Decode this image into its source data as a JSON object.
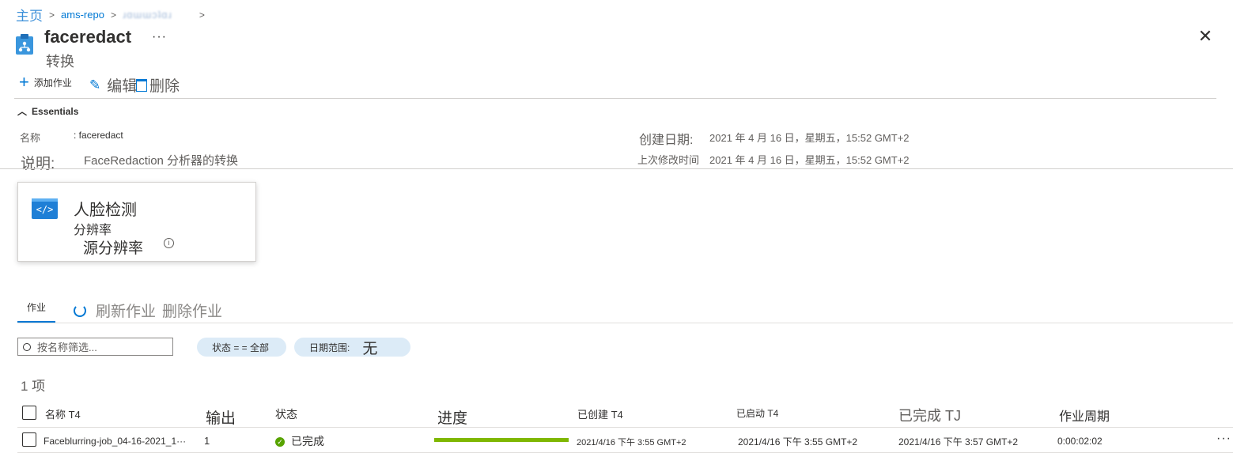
{
  "breadcrumb": {
    "home": "主页",
    "repo": "ams-repo",
    "blurred": "ɹɑɯɯɔʇɑɹ"
  },
  "header": {
    "title": "faceredact",
    "more": "···",
    "subtitle": "转换",
    "close": "✕"
  },
  "commands": {
    "add_job": "添加作业",
    "edit": "编辑",
    "delete": "删除"
  },
  "essentials": {
    "toggle": "Essentials",
    "name_label": "名称",
    "name_value": ": faceredact",
    "desc_label": "说明:",
    "desc_value": "FaceRedaction 分析器的转换",
    "created_label": "创建日期:",
    "created_value": "2021 年 4 月 16 日，星期五，15:52 GMT+2",
    "modified_label": "上次修改时间",
    "modified_value": "2021 年 4 月 16 日，星期五，15:52 GMT+2"
  },
  "card": {
    "icon": "</>",
    "title": "人脸检测",
    "line1": "分辨率",
    "line2": "源分辨率",
    "info": "i"
  },
  "jobs_tab": {
    "tab": "作业",
    "refresh": "刷新作业",
    "delete": "删除作业"
  },
  "filters": {
    "search_placeholder": "按名称筛选...",
    "status_pill": "状态 =  = 全部",
    "date_label": "日期范围:",
    "date_value": "无"
  },
  "count": "1 项",
  "table": {
    "headers": {
      "name": "名称 T4",
      "output": "输出",
      "status": "状态",
      "progress": "进度",
      "created": "已创建 T4",
      "started": "已启动 T4",
      "finished": "已完成 TJ",
      "duration": "作业周期"
    },
    "rows": [
      {
        "name": "Faceblurring-job_04-16-2021_1···",
        "output": "1",
        "status": "已完成",
        "progress": 1.0,
        "created": "2021/4/16 下午 3:55 GMT+2",
        "started": "2021/4/16 下午 3:55 GMT+2",
        "finished": "2021/4/16 下午 3:57 GMT+2",
        "duration": "0:00:02:02",
        "more": "···"
      }
    ]
  },
  "colors": {
    "accent": "#0078d4",
    "success": "#57a300",
    "progress": "#7fb700",
    "pill": "#dcebf7"
  }
}
